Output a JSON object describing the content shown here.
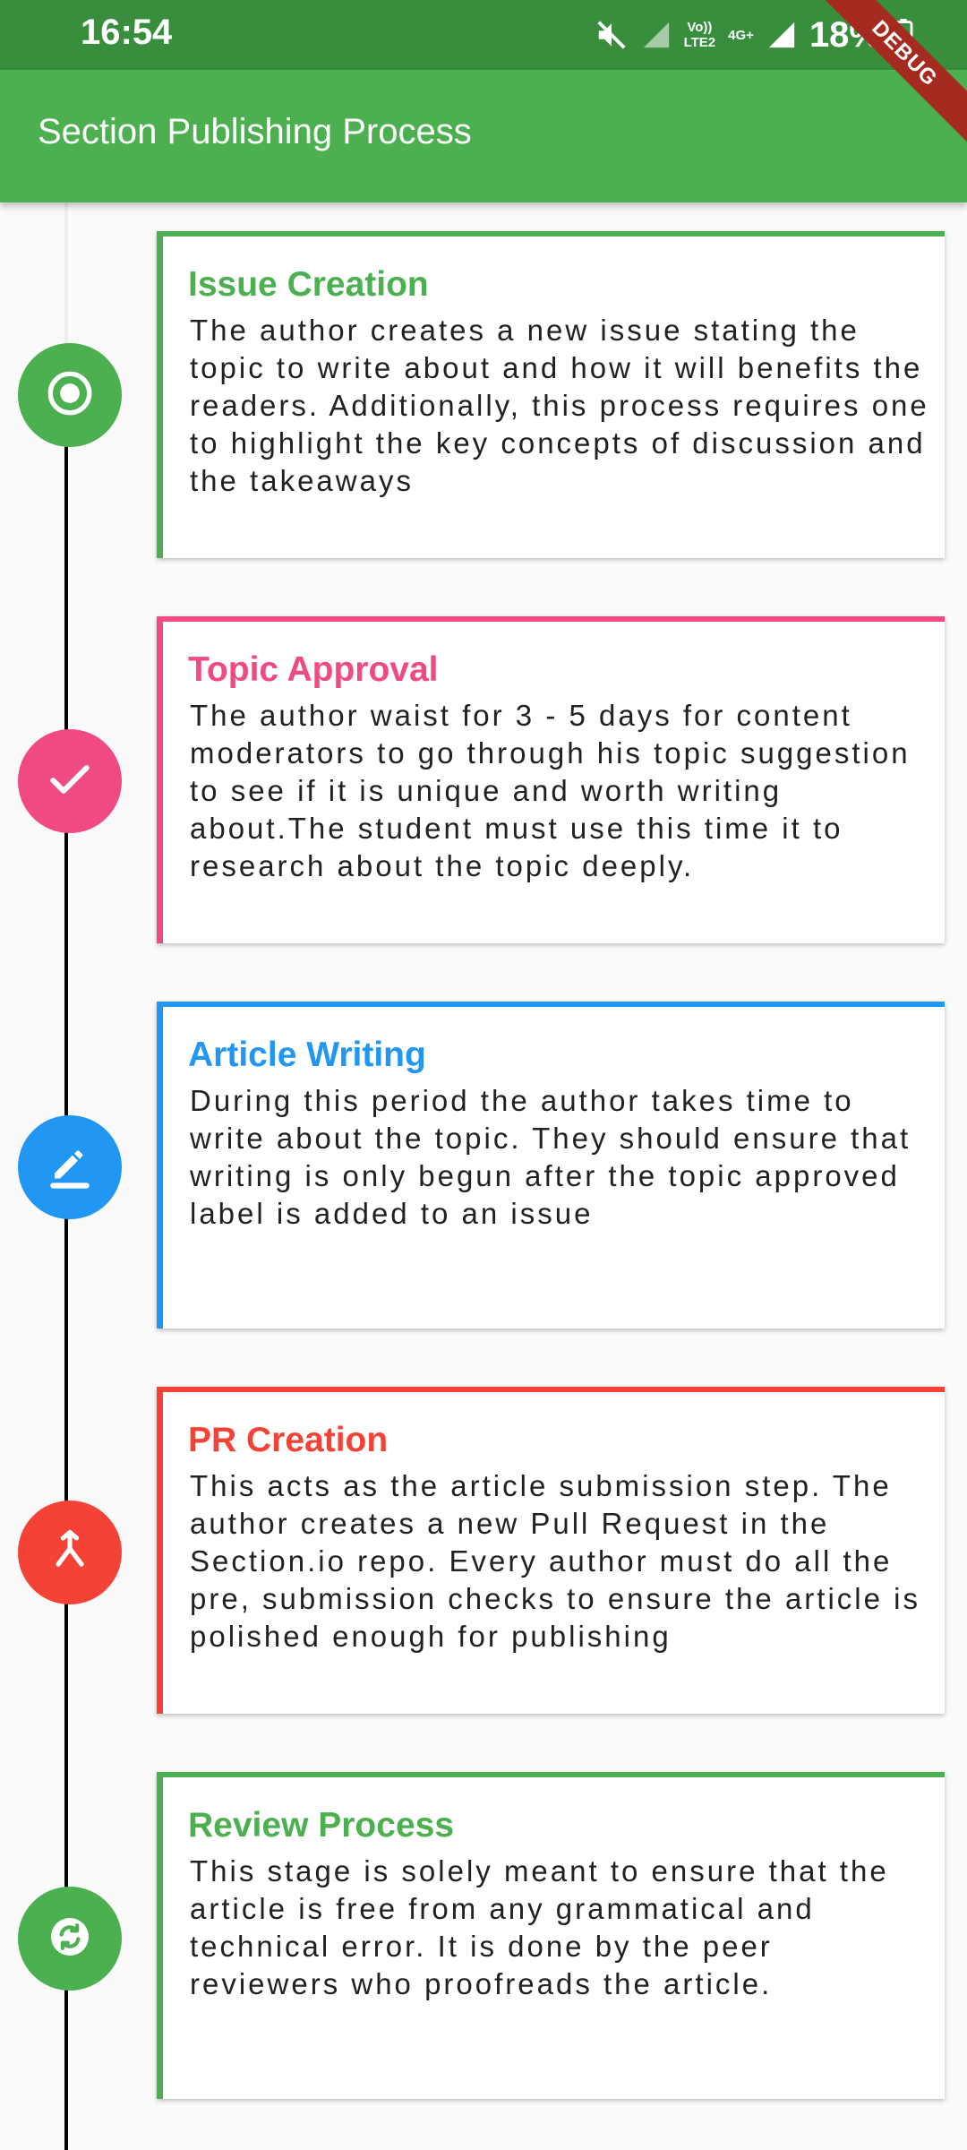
{
  "status_bar": {
    "time": "16:54",
    "network_label_1": "Vo))",
    "network_label_2": "LTE2",
    "network_type": "4G+",
    "battery": "18%",
    "icons": [
      "mute-icon",
      "signal-icon",
      "signal-icon",
      "battery-icon"
    ]
  },
  "debug_banner": "DEBUG",
  "appbar": {
    "title": "Section Publishing Process"
  },
  "steps": [
    {
      "title": "Issue Creation",
      "description": "The author creates a new issue stating the topic to write about and how it will benefits the readers. Additionally, this process requires one to highlight the key concepts of discussion and the takeaways",
      "color": "#4caf50",
      "icon": "radio-button-icon"
    },
    {
      "title": "Topic Approval",
      "description": "The author waist for 3 - 5 days for content moderators to go through his topic suggestion to see if it is unique and worth writing about.The student must use this time it to research about the topic deeply.",
      "color": "#f04a84",
      "icon": "check-icon"
    },
    {
      "title": "Article Writing",
      "description": "During this period the author takes time to write about the topic. They should ensure that writing is only begun after the topic approved label is added to an issue",
      "color": "#2196f3",
      "icon": "edit-icon"
    },
    {
      "title": "PR Creation",
      "description": "This acts as the article submission step. The author creates a new Pull Request in the Section.io repo. Every author must do all the pre, submission checks to ensure the article is polished enough for publishing",
      "color": "#f44336",
      "icon": "merge-icon"
    },
    {
      "title": "Review Process",
      "description": "This stage is solely meant to ensure that the article is free from any grammatical and technical error. It is done by the peer reviewers who proofreads the article.",
      "color": "#4caf50",
      "icon": "sync-icon"
    }
  ]
}
